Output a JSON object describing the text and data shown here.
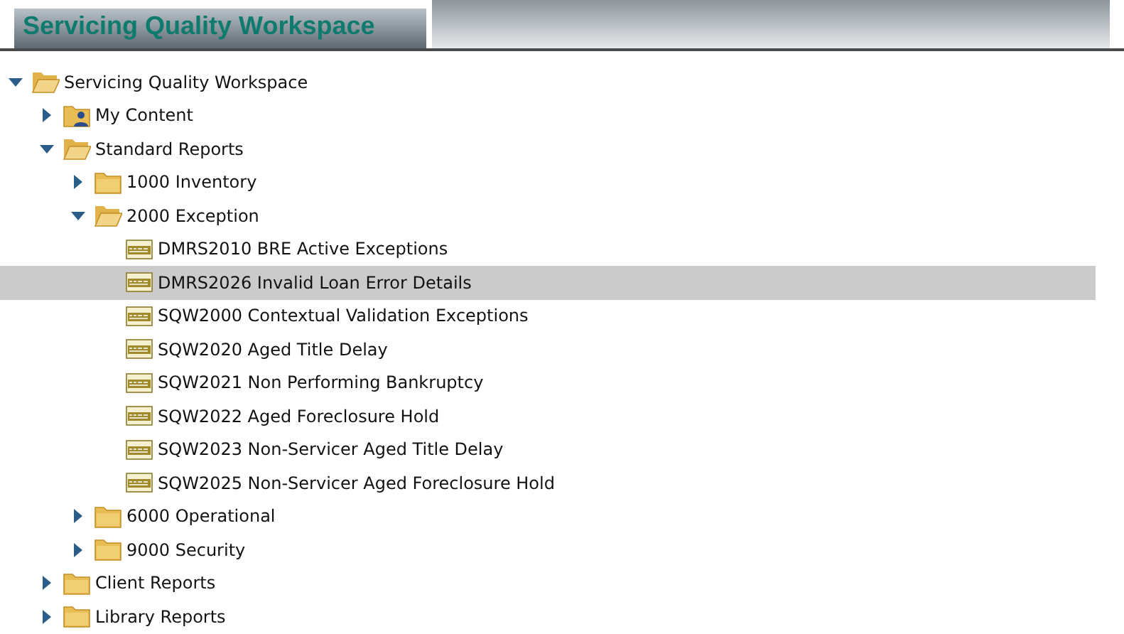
{
  "header": {
    "title": "Servicing Quality Workspace"
  },
  "tree": [
    {
      "label": "Servicing Quality Workspace",
      "kind": "folder",
      "expanded": true,
      "selected": false,
      "children": [
        {
          "label": "My Content",
          "kind": "user-folder",
          "expanded": false,
          "selected": false
        },
        {
          "label": "Standard Reports",
          "kind": "folder",
          "expanded": true,
          "selected": false,
          "children": [
            {
              "label": "1000 Inventory",
              "kind": "folder",
              "expanded": false,
              "selected": false
            },
            {
              "label": "2000 Exception",
              "kind": "folder",
              "expanded": true,
              "selected": false,
              "children": [
                {
                  "label": "DMRS2010 BRE Active Exceptions",
                  "kind": "report",
                  "selected": false
                },
                {
                  "label": "DMRS2026 Invalid Loan Error Details",
                  "kind": "report",
                  "selected": true
                },
                {
                  "label": "SQW2000 Contextual Validation Exceptions",
                  "kind": "report",
                  "selected": false
                },
                {
                  "label": "SQW2020 Aged Title Delay",
                  "kind": "report",
                  "selected": false
                },
                {
                  "label": "SQW2021 Non Performing Bankruptcy",
                  "kind": "report",
                  "selected": false
                },
                {
                  "label": "SQW2022 Aged Foreclosure Hold",
                  "kind": "report",
                  "selected": false
                },
                {
                  "label": "SQW2023 Non-Servicer Aged Title Delay",
                  "kind": "report",
                  "selected": false
                },
                {
                  "label": "SQW2025 Non-Servicer Aged Foreclosure Hold",
                  "kind": "report",
                  "selected": false
                }
              ]
            },
            {
              "label": "6000 Operational",
              "kind": "folder",
              "expanded": false,
              "selected": false
            },
            {
              "label": "9000 Security",
              "kind": "folder",
              "expanded": false,
              "selected": false
            }
          ]
        },
        {
          "label": "Client Reports",
          "kind": "folder",
          "expanded": false,
          "selected": false
        },
        {
          "label": "Library Reports",
          "kind": "folder",
          "expanded": false,
          "selected": false
        }
      ]
    }
  ]
}
